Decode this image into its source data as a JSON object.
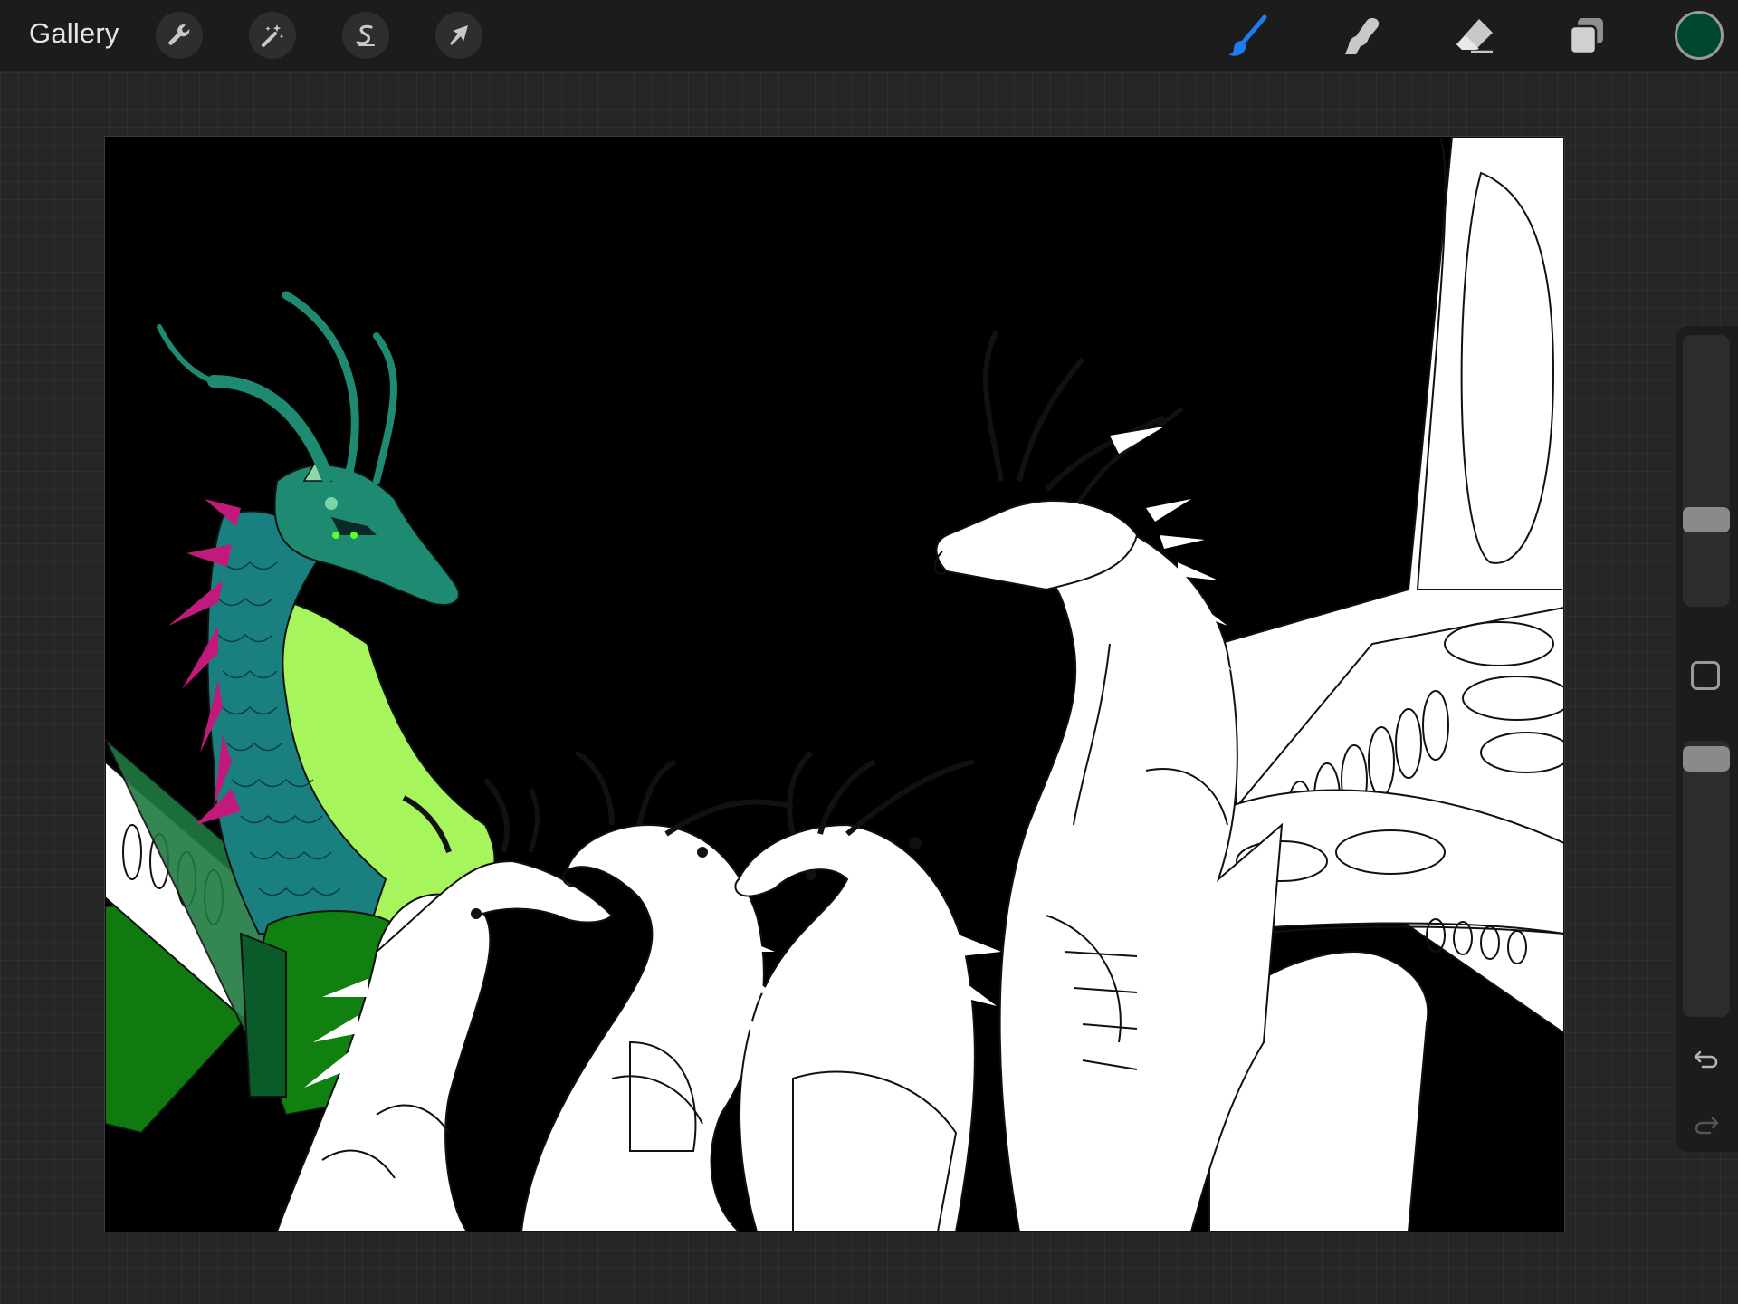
{
  "topbar": {
    "gallery_label": "Gallery",
    "left_tools": [
      {
        "icon": "wrench-icon",
        "name": "actions"
      },
      {
        "icon": "magic-wand-icon",
        "name": "adjustments"
      },
      {
        "icon": "selection-s-icon",
        "name": "selection"
      },
      {
        "icon": "arrow-cursor-icon",
        "name": "transform"
      }
    ],
    "right_tools": [
      {
        "icon": "brush-icon",
        "name": "brush",
        "active": true
      },
      {
        "icon": "smudge-icon",
        "name": "smudge"
      },
      {
        "icon": "eraser-icon",
        "name": "eraser"
      },
      {
        "icon": "layers-icon",
        "name": "layers"
      }
    ],
    "current_color": "#00472f"
  },
  "colors": {
    "accent_blue": "#1e7cf0",
    "dragon_teal": "#1f8a72",
    "dragon_green_belly": "#a6f55c",
    "dragon_scales": "#1a7f7f",
    "dragon_spikes": "#c21a7c",
    "dragon_wing_green": "#107a10",
    "line_art": "#111111",
    "background": "#000000"
  },
  "sidebar": {
    "brush_size_level": 0.45,
    "opacity_level": 0.03,
    "icons": [
      "modify-square-icon",
      "undo-icon",
      "redo-icon"
    ]
  }
}
